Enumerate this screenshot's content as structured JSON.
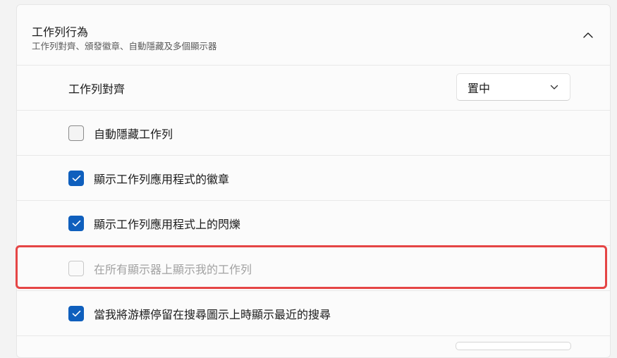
{
  "section": {
    "title": "工作列行為",
    "subtitle": "工作列對齊、頒發徽章、自動隱藏及多個顯示器",
    "collapse_icon": "chevron-up-icon"
  },
  "alignment": {
    "label": "工作列對齊",
    "selected": "置中",
    "dropdown_icon": "chevron-down-icon"
  },
  "options": [
    {
      "label": "自動隱藏工作列",
      "checked": false,
      "disabled": false
    },
    {
      "label": "顯示工作列應用程式的徽章",
      "checked": true,
      "disabled": false
    },
    {
      "label": "顯示工作列應用程式上的閃爍",
      "checked": true,
      "disabled": false
    },
    {
      "label": "在所有顯示器上顯示我的工作列",
      "checked": false,
      "disabled": true
    },
    {
      "label": "當我將游標停留在搜尋圖示上時顯示最近的搜尋",
      "checked": true,
      "disabled": false
    }
  ],
  "colors": {
    "accent": "#0f5fbd",
    "highlight": "#e54545"
  }
}
